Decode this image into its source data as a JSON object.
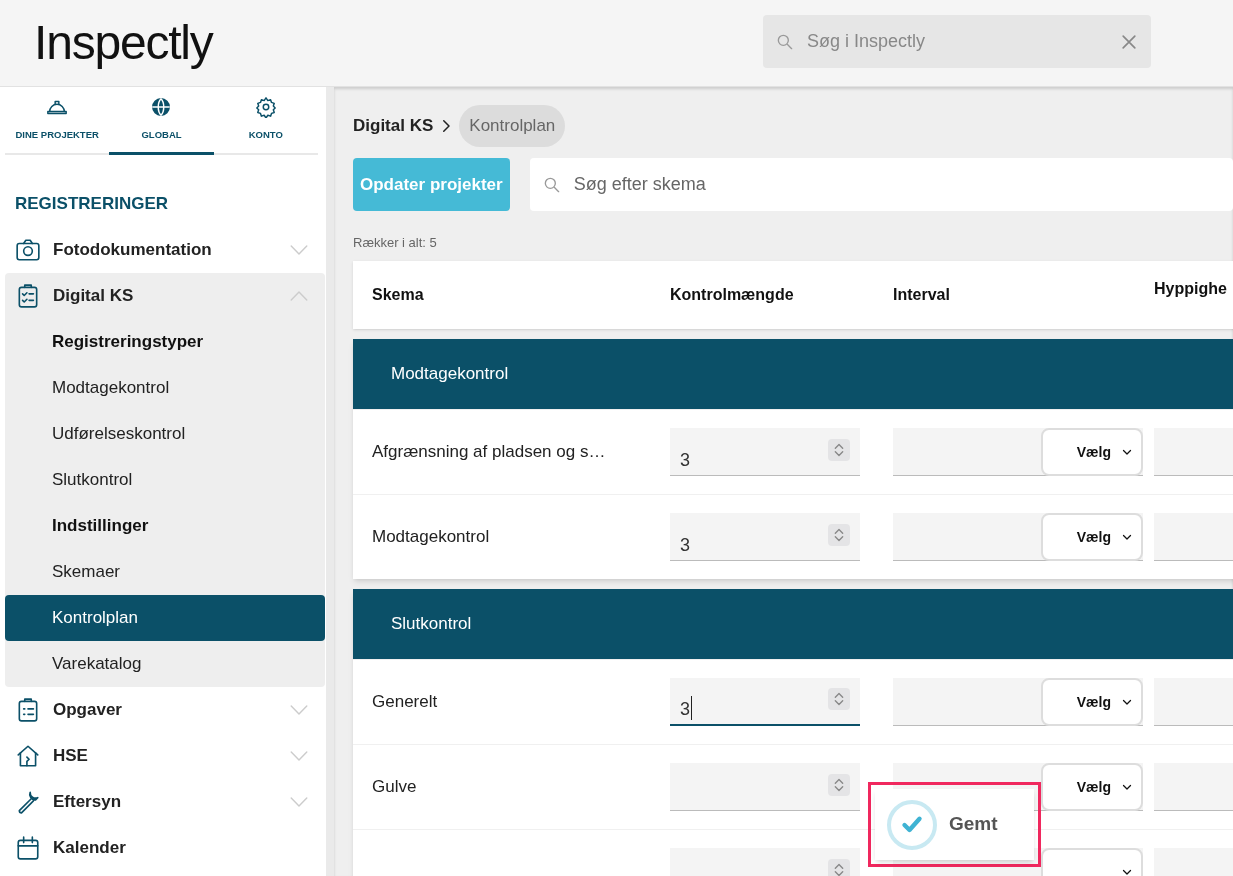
{
  "header": {
    "logo": "Inspectly",
    "search": {
      "placeholder": "Søg i Inspectly"
    }
  },
  "sidebar": {
    "tabs": [
      {
        "label": "DINE PROJEKTER",
        "selected": false
      },
      {
        "label": "GLOBAL",
        "selected": true
      },
      {
        "label": "KONTO",
        "selected": false
      }
    ],
    "section_title": "REGISTRERINGER",
    "items": [
      {
        "label": "Fotodokumentation",
        "expanded": false
      },
      {
        "label": "Digital KS",
        "expanded": true,
        "children": [
          {
            "label": "Registreringstyper",
            "kind": "heading"
          },
          {
            "label": "Modtagekontrol",
            "kind": "link",
            "selected": false
          },
          {
            "label": "Udførelseskontrol",
            "kind": "link",
            "selected": false
          },
          {
            "label": "Slutkontrol",
            "kind": "link",
            "selected": false
          },
          {
            "label": "Indstillinger",
            "kind": "heading"
          },
          {
            "label": "Skemaer",
            "kind": "link",
            "selected": false
          },
          {
            "label": "Kontrolplan",
            "kind": "link",
            "selected": true
          },
          {
            "label": "Varekatalog",
            "kind": "link",
            "selected": false
          }
        ]
      },
      {
        "label": "Opgaver",
        "expanded": false
      },
      {
        "label": "HSE",
        "expanded": false
      },
      {
        "label": "Eftersyn",
        "expanded": false
      },
      {
        "label": "Kalender"
      }
    ]
  },
  "main": {
    "breadcrumb": [
      {
        "label": "Digital KS",
        "selected": false
      },
      {
        "label": "Kontrolplan",
        "selected": true
      }
    ],
    "update_button": "Opdater projekter",
    "search": {
      "placeholder": "Søg efter skema"
    },
    "row_count": "Rækker i alt: 5",
    "table": {
      "columns": [
        "Skema",
        "Kontrolmængde",
        "Interval",
        "Hyppighe"
      ],
      "groups": [
        {
          "title": "Modtagekontrol",
          "rows": [
            {
              "skema": "Afgrænsning af pladsen og s…",
              "quantity": "3",
              "focused": false,
              "select": "Vælg"
            },
            {
              "skema": "Modtagekontrol",
              "quantity": "3",
              "focused": false,
              "select": "Vælg"
            }
          ]
        },
        {
          "title": "Slutkontrol",
          "rows": [
            {
              "skema": "Generelt",
              "quantity": "3",
              "focused": true,
              "select": "Vælg"
            },
            {
              "skema": "Gulve",
              "focused": false,
              "select": "Vælg"
            },
            {
              "focused": false
            }
          ]
        }
      ]
    }
  },
  "toast": {
    "text": "Gemt",
    "highlighted": true
  }
}
